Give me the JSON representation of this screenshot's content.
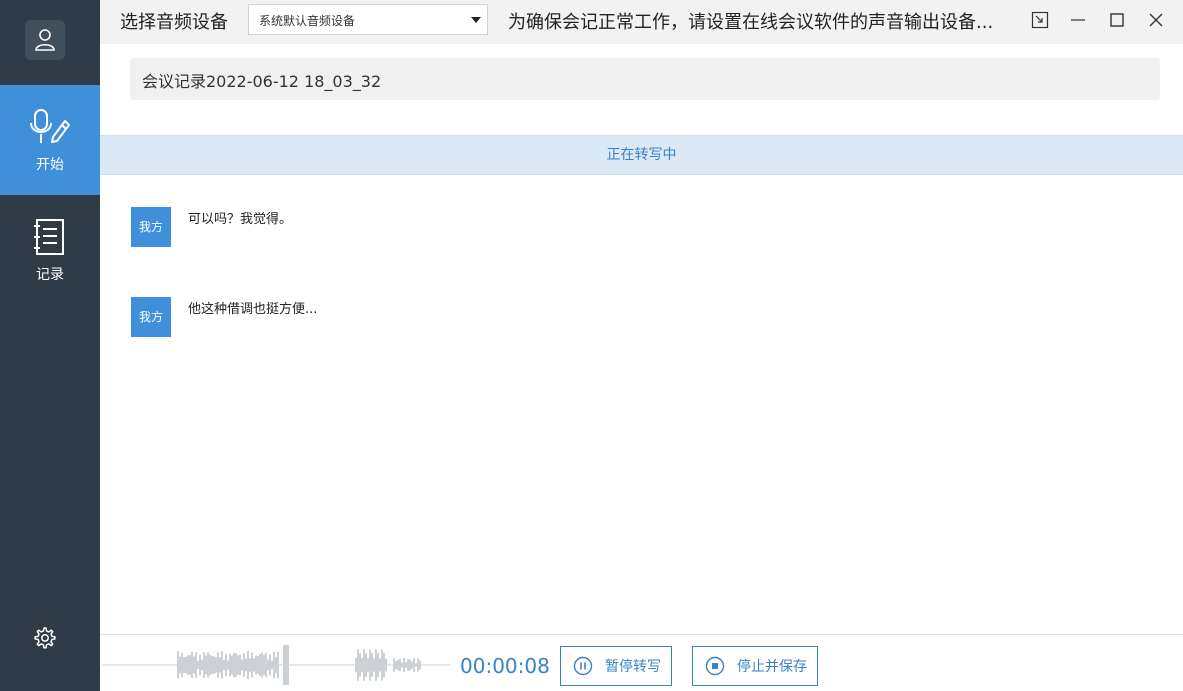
{
  "colors": {
    "sidebar_bg": "#2f3b47",
    "accent": "#3f8fdb",
    "accent_text": "#3a82c8",
    "status_bg": "#dbe9f6"
  },
  "sidebar": {
    "avatar_icon": "user-icon",
    "items": [
      {
        "label": "开始",
        "icon": "microphone-pen-icon",
        "active": true
      },
      {
        "label": "记录",
        "icon": "notebook-icon",
        "active": false
      }
    ],
    "settings_icon": "gear-icon"
  },
  "header": {
    "device_label": "选择音频设备",
    "device_selected": "系统默认音频设备",
    "tip": "为确保会记正常工作，请设置在线会议软件的声音输出设备...",
    "window_buttons": [
      "pin-icon",
      "minimize-icon",
      "maximize-icon",
      "close-icon"
    ]
  },
  "meeting": {
    "title": "会议记录2022-06-12 18_03_32"
  },
  "status": {
    "text": "正在转写中"
  },
  "transcript": [
    {
      "speaker": "我方",
      "text": "可以吗？我觉得。"
    },
    {
      "speaker": "我方",
      "text": "他这种借调也挺方便..."
    }
  ],
  "controls": {
    "timer": "00:00:08",
    "pause_label": "暂停转写",
    "stop_label": "停止并保存"
  }
}
